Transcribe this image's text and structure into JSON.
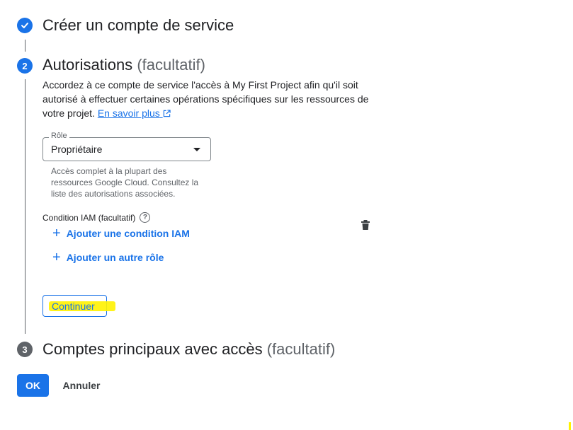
{
  "steps": [
    {
      "number": "1",
      "title": "Créer un compte de service",
      "suffix": "",
      "state": "done",
      "icon": "check-icon"
    },
    {
      "number": "2",
      "title": "Autorisations",
      "suffix": "(facultatif)",
      "state": "active"
    },
    {
      "number": "3",
      "title": "Comptes principaux avec accès",
      "suffix": "(facultatif)",
      "state": "pending"
    }
  ],
  "permissions": {
    "description": "Accordez à ce compte de service l'accès à My First Project afin qu'il soit autorisé à effectuer certaines opérations spécifiques sur les ressources de votre projet.",
    "learn_more": "En savoir plus",
    "learn_more_icon": "external-link-icon",
    "role_field": {
      "label": "Rôle",
      "value": "Propriétaire",
      "hint": "Accès complet à la plupart des ressources Google Cloud. Consultez la liste des autorisations associées."
    },
    "iam_condition": {
      "label": "Condition IAM (facultatif)",
      "help_icon": "help-icon"
    },
    "add_condition": "Ajouter une condition IAM",
    "add_role": "Ajouter un autre rôle",
    "delete_icon": "trash-icon",
    "continue_button": "Continuer"
  },
  "footer": {
    "ok_button": "OK",
    "cancel_button": "Annuler"
  },
  "colors": {
    "accent": "#1a73e8",
    "pending_step": "#5f6368",
    "highlight": "#fff200"
  }
}
